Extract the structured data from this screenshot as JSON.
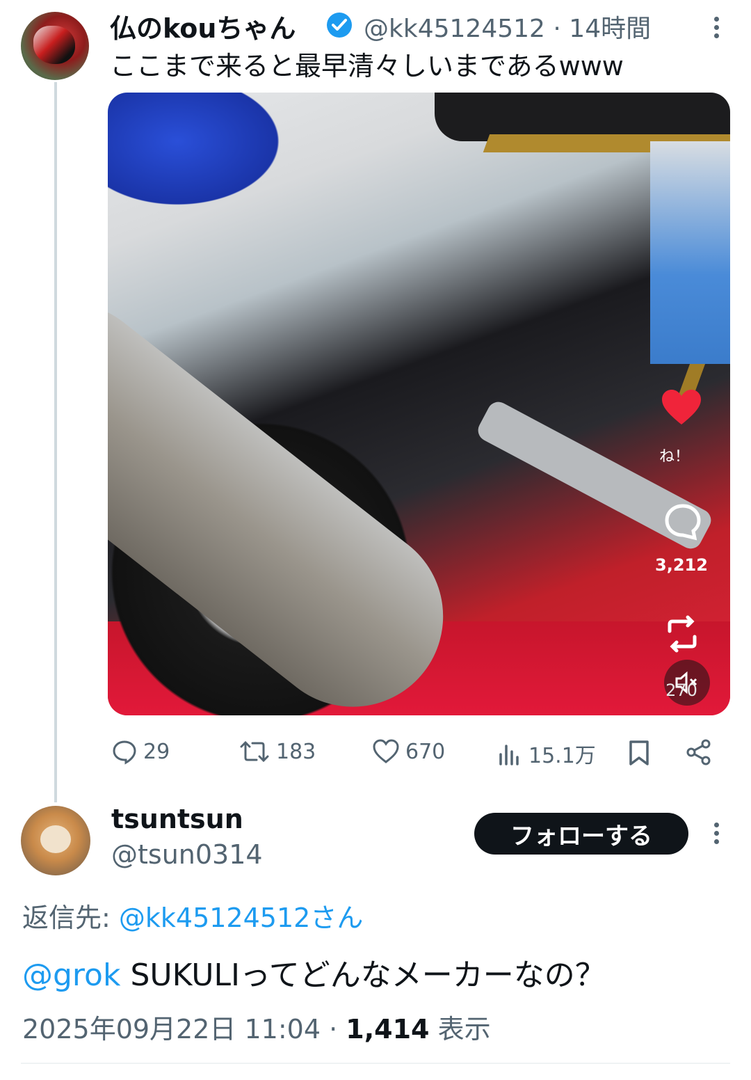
{
  "tweet": {
    "author_name": "仏のkouちゃん",
    "handle": "@kk45124512",
    "separator": "·",
    "time": "14時間",
    "text": "ここまで来ると最早清々しいまであるwww",
    "media_overlay": {
      "like_label": "ね！",
      "comment_count": "3,212",
      "mute_count": "270"
    },
    "actions": {
      "replies": "29",
      "reposts": "183",
      "likes": "670",
      "views": "15.1万"
    }
  },
  "reply": {
    "author_name": "tsuntsun",
    "handle": "@tsun0314",
    "follow_label": "フォローする",
    "reply_to_prefix": "返信先: ",
    "reply_to_handle": "@kk45124512さん",
    "mention": "@grok",
    "text": " SUKULIってどんなメーカーなの？",
    "date": "2025年09月22日 11:04",
    "separator": "·",
    "views_count": "1,414",
    "views_label": " 表示"
  },
  "colors": {
    "accent": "#1d9bf0",
    "secondary_text": "#536471",
    "primary_text": "#0f1419"
  },
  "icons": [
    "verified-icon",
    "more-icon",
    "reply-icon",
    "repost-icon",
    "like-icon",
    "views-icon",
    "bookmark-icon",
    "share-icon",
    "heart-overlay-icon",
    "comment-overlay-icon",
    "repost-overlay-icon",
    "mute-icon"
  ]
}
